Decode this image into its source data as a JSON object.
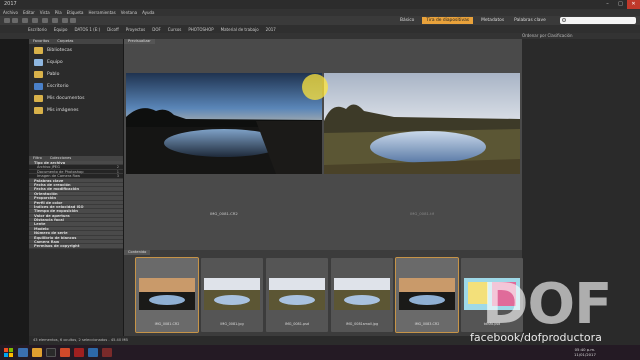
{
  "window": {
    "title": "2017"
  },
  "menu": [
    "Archivo",
    "Editar",
    "Vista",
    "Pila",
    "Etiqueta",
    "Herramientas",
    "Ventana",
    "Ayuda"
  ],
  "workspaces": {
    "items": [
      "Básico",
      "Tira de diapositivas",
      "Metadatos",
      "Palabras clave"
    ],
    "active_index": 1
  },
  "path": [
    "Escritorio",
    "Equipo",
    "DATOS 1 (E:)",
    "Dicoff",
    "Proyectos",
    "DOF",
    "Cursos",
    "PHOTOSHOP",
    "Material de trabajo",
    "2017"
  ],
  "sort": {
    "label": "Ordenar por Clasificación"
  },
  "panels": {
    "favorites_tab": "Favoritos",
    "folders_tab": "Carpetas",
    "filter_tab": "Filtro",
    "collections_tab": "Colecciones",
    "preview_tab": "Previsualizar",
    "content_tab": "Contenido"
  },
  "favorites": [
    {
      "label": "Bibliotecas",
      "icon": "library-folder-icon",
      "color": "#d9b24a"
    },
    {
      "label": "Equipo",
      "icon": "computer-icon",
      "color": "#8fb7e0"
    },
    {
      "label": "Pablo",
      "icon": "user-folder-icon",
      "color": "#d9b24a"
    },
    {
      "label": "Escritorio",
      "icon": "desktop-icon",
      "color": "#4a80c8"
    },
    {
      "label": "Mis documentos",
      "icon": "documents-icon",
      "color": "#d9b24a"
    },
    {
      "label": "Mis imágenes",
      "icon": "pictures-icon",
      "color": "#d9b24a"
    }
  ],
  "filters": [
    {
      "label": "Tipo de archivo",
      "type": "head"
    },
    {
      "label": "Archivo JPEG",
      "count": "2",
      "type": "sub"
    },
    {
      "label": "Documento de Photoshop",
      "count": "1",
      "type": "sub"
    },
    {
      "label": "Imagen de Camera Raw",
      "count": "3",
      "type": "sub"
    },
    {
      "label": "Palabras clave",
      "type": "head"
    },
    {
      "label": "Fecha de creación",
      "type": "head"
    },
    {
      "label": "Fecha de modificación",
      "type": "head"
    },
    {
      "label": "Orientación",
      "type": "head"
    },
    {
      "label": "Proporción",
      "type": "head"
    },
    {
      "label": "Perfil de color",
      "type": "head"
    },
    {
      "label": "Índices de velocidad ISO",
      "type": "head"
    },
    {
      "label": "Tiempo de exposición",
      "type": "head"
    },
    {
      "label": "Valor de apertura",
      "type": "head"
    },
    {
      "label": "Distancia focal",
      "type": "head"
    },
    {
      "label": "Lente",
      "type": "head"
    },
    {
      "label": "Modelo",
      "type": "head"
    },
    {
      "label": "Número de serie",
      "type": "head"
    },
    {
      "label": "Equilibrio de blancos",
      "type": "head"
    },
    {
      "label": "Camera Raw",
      "type": "head"
    },
    {
      "label": "Permisos de copyright",
      "type": "head"
    }
  ],
  "preview": {
    "left_label": "IMG_0081.CR2",
    "right_label": "IMG_0081.tif"
  },
  "thumbnails": [
    {
      "label": "IMG_0081.CR2",
      "selected": true,
      "scene": "sunset"
    },
    {
      "label": "IMG_0081.jpg",
      "selected": false,
      "scene": "day"
    },
    {
      "label": "IMG_0081.psd",
      "selected": false,
      "scene": "day"
    },
    {
      "label": "IMG_0081small.jpg",
      "selected": false,
      "scene": "day"
    },
    {
      "label": "IMG_0083.CR2",
      "selected": true,
      "scene": "sunset"
    },
    {
      "label": "tdisfo.psd",
      "selected": false,
      "scene": "poster"
    }
  ],
  "status": {
    "text": "43 elementos, 6 ocultos, 2 seleccionados - 45.40 MB"
  },
  "clock": {
    "time": "05:40 p.m.",
    "date": "11/01/2017"
  },
  "watermark": {
    "logo": "DOF",
    "url": "facebook/dofproductora"
  },
  "colors": {
    "accent": "#e9a23b",
    "selection": "#c69448",
    "close": "#c0392b"
  }
}
